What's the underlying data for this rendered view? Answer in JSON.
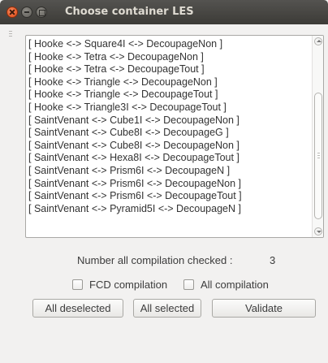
{
  "window": {
    "title": "Choose container LES"
  },
  "list": {
    "items": [
      "[ Hooke <-> Square4I <-> DecoupageNon ]",
      "[ Hooke <-> Tetra <-> DecoupageNon ]",
      "[ Hooke <-> Tetra <-> DecoupageTout ]",
      "[ Hooke <-> Triangle <-> DecoupageNon ]",
      "[ Hooke <-> Triangle <-> DecoupageTout ]",
      "[ Hooke <-> Triangle3I <-> DecoupageTout ]",
      "[ SaintVenant <-> Cube1I <-> DecoupageNon ]",
      "[ SaintVenant <-> Cube8I <-> DecoupageG ]",
      "[ SaintVenant <-> Cube8I <-> DecoupageNon ]",
      "[ SaintVenant <-> Hexa8I <-> DecoupageTout ]",
      "[ SaintVenant <-> Prism6I <-> DecoupageN ]",
      "[ SaintVenant <-> Prism6I <-> DecoupageNon ]",
      "[ SaintVenant <-> Prism6I <-> DecoupageTout ]",
      "[ SaintVenant <-> Pyramid5I <-> DecoupageN ]"
    ]
  },
  "status": {
    "count_label": "Number all compilation checked :",
    "count_value": "3"
  },
  "options": {
    "fcd_label": "FCD compilation",
    "all_label": "All compilation"
  },
  "buttons": {
    "deselect": "All deselected",
    "select": "All selected",
    "validate": "Validate"
  }
}
